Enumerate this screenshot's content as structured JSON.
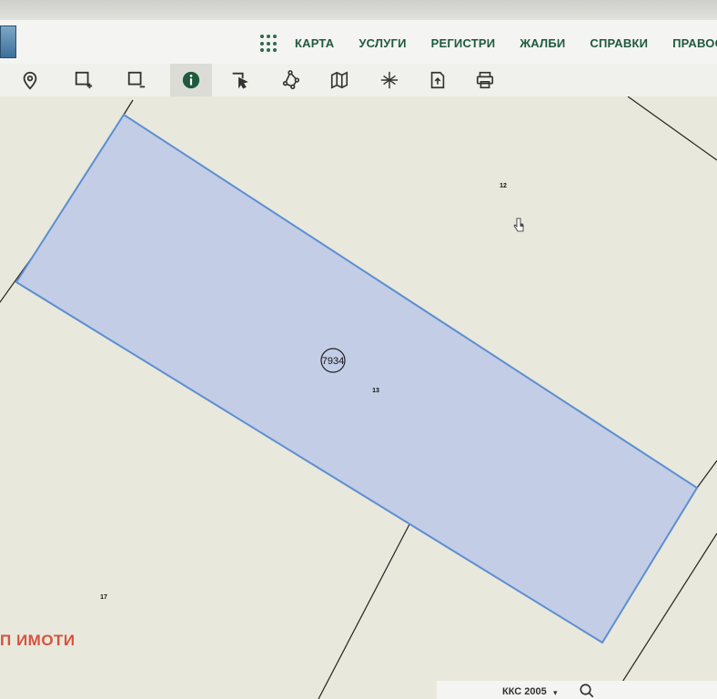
{
  "nav": {
    "items": [
      {
        "label": "КАРТА"
      },
      {
        "label": "УСЛУГИ"
      },
      {
        "label": "РЕГИСТРИ"
      },
      {
        "label": "ЖАЛБИ"
      },
      {
        "label": "СПРАВКИ"
      },
      {
        "label": "ПРАВОС"
      }
    ]
  },
  "toolbar": {
    "tools": [
      {
        "icon": "location-pin-icon"
      },
      {
        "icon": "add-selection-icon"
      },
      {
        "icon": "remove-selection-icon"
      },
      {
        "icon": "info-icon",
        "active": true
      },
      {
        "icon": "pointer-tool-icon"
      },
      {
        "icon": "polygon-icon"
      },
      {
        "icon": "map-icon"
      },
      {
        "icon": "crosshair-icon"
      },
      {
        "icon": "export-icon"
      },
      {
        "icon": "print-icon"
      }
    ]
  },
  "map": {
    "parcel_main_id": "7934",
    "parcel_main_num": "13",
    "parcel_ne_num": "12",
    "parcel_sw_num": "17",
    "highlight_color": "#c3cde6",
    "border_color": "#5b8fd1"
  },
  "overlay": {
    "red_label": "П ИМОТИ"
  },
  "status": {
    "crs": "ККС 2005",
    "crs_caret": "▾"
  },
  "colors": {
    "nav_text": "#1f5a3c",
    "info_active": "#1f5a3c",
    "map_bg": "#e9e8dc"
  }
}
